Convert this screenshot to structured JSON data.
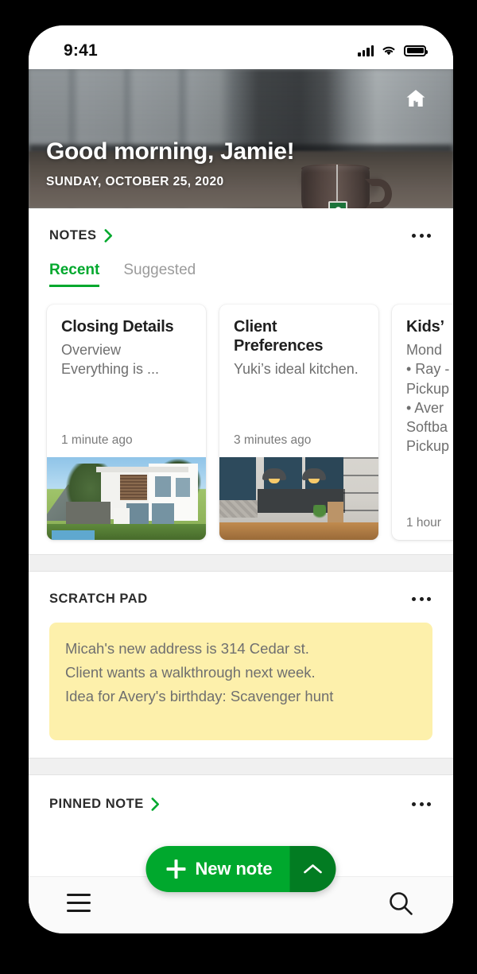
{
  "status_bar": {
    "time": "9:41",
    "signal_icon": "cellular-signal-icon",
    "wifi_icon": "wifi-icon",
    "battery_icon": "battery-full-icon"
  },
  "hero": {
    "greeting": "Good morning, Jamie!",
    "date": "SUNDAY, OCTOBER 25, 2020",
    "home_edit_icon": "home-edit-icon"
  },
  "notes_section": {
    "title": "NOTES",
    "chevron_icon": "chevron-right-icon",
    "overflow_icon": "more-options-icon",
    "tabs": [
      {
        "label": "Recent",
        "active": true
      },
      {
        "label": "Suggested",
        "active": false
      }
    ],
    "cards": [
      {
        "title": "Closing Details",
        "snippet": "Overview\nEverything is ...",
        "time": "1 minute ago",
        "thumbnail": "modern-house-photo"
      },
      {
        "title": "Client Preferences",
        "snippet": "Yuki’s ideal kitchen.",
        "time": "3 minutes ago",
        "thumbnail": "blue-kitchen-photo"
      },
      {
        "title": "Kids’",
        "snippet": "Mond\n• Ray -\nPickup\n• Aver\nSoftba\nPickup",
        "time": "1 hour",
        "thumbnail": "none"
      }
    ]
  },
  "scratch_pad": {
    "title": "SCRATCH PAD",
    "overflow_icon": "more-options-icon",
    "lines": [
      "Micah's new address is 314 Cedar st.",
      "Client wants a walkthrough next week.",
      "Idea for Avery's birthday: Scavenger hunt"
    ]
  },
  "pinned_note": {
    "title": "PINNED NOTE",
    "chevron_icon": "chevron-right-icon",
    "overflow_icon": "more-options-icon"
  },
  "fab": {
    "label": "New note",
    "plus_icon": "plus-icon",
    "expand_icon": "chevron-up-icon"
  },
  "bottom_nav": {
    "menu_icon": "hamburger-menu-icon",
    "search_icon": "search-icon"
  },
  "colors": {
    "brand_green": "#00a82d",
    "brand_green_dark": "#027c22",
    "sticky_yellow": "#fdf0ab",
    "muted_text": "#6f6f6f",
    "divider": "#f0f0f0"
  }
}
